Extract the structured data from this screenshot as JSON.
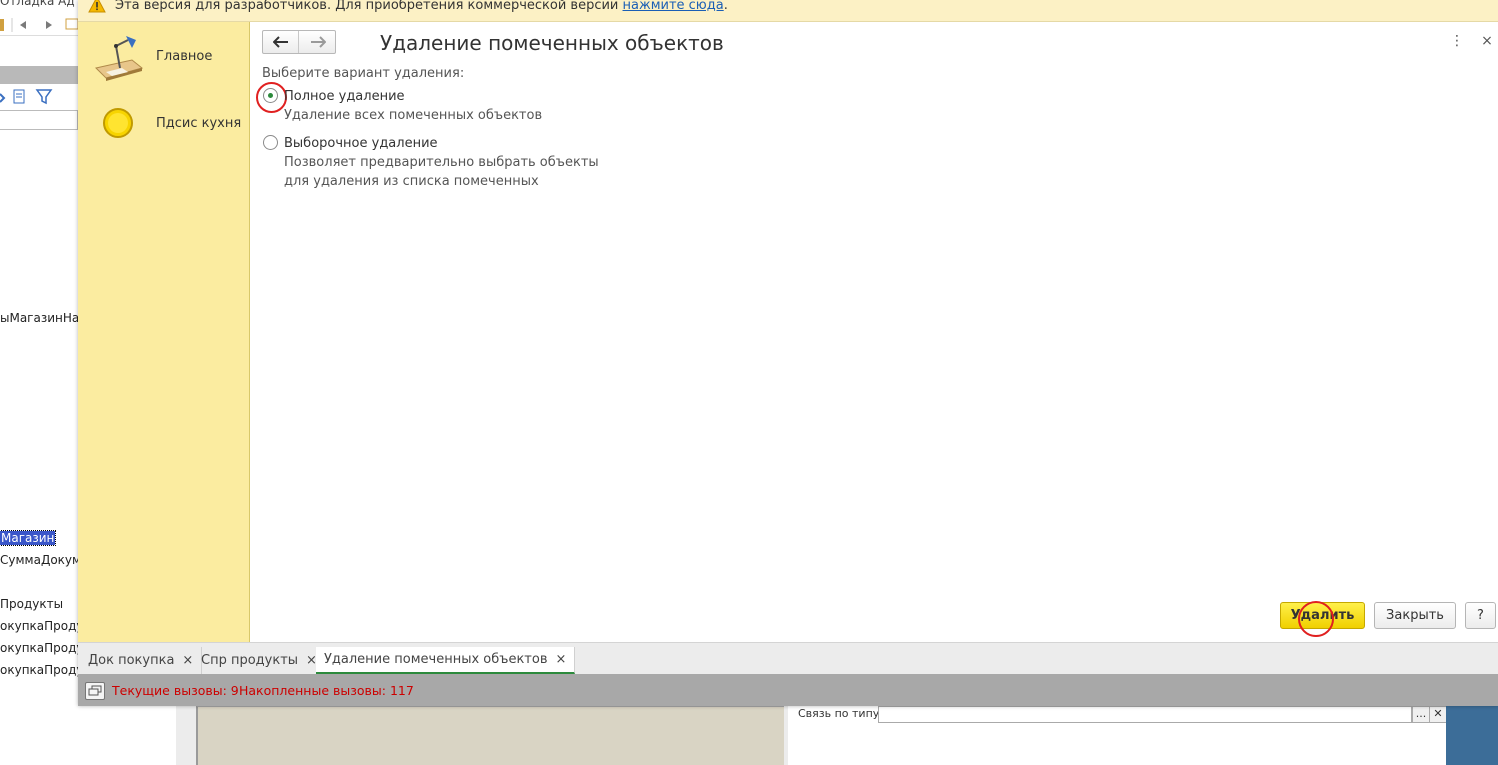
{
  "background": {
    "menu_fragment": "Отладка   Ад",
    "code_lines": [
      "ыМагазинНазва",
      "Магазин",
      "СуммаДокумен",
      "Продукты",
      "окупкаПродук",
      "окупкаПродук",
      "окупкаПродук"
    ],
    "bottom_panel": {
      "link_by_type_label": "Связь по типу",
      "ellipsis_button": "...",
      "clear_button": "✕"
    }
  },
  "banner": {
    "text": "Эта версия для разработчиков. Для приобретения коммерческой версии",
    "link": "нажмите сюда",
    "suffix": "."
  },
  "sidebar": {
    "items": [
      {
        "label": "Главное",
        "icon": "desk-lamp-icon"
      },
      {
        "label": "Пдсис кухня",
        "icon": "yellow-circle-icon"
      }
    ]
  },
  "form": {
    "title": "Удаление помеченных объектов",
    "prompt": "Выберите вариант удаления:",
    "options": [
      {
        "title": "Полное удаление",
        "description": [
          "Удаление всех помеченных объектов"
        ],
        "checked": true
      },
      {
        "title": "Выборочное удаление",
        "description": [
          "Позволяет предварительно выбрать объекты",
          "для удаления из списка помеченных"
        ],
        "checked": false
      }
    ],
    "buttons": {
      "delete": "Удалить",
      "close": "Закрыть",
      "help": "?"
    },
    "header_icons": {
      "more": "⋮",
      "close": "×"
    }
  },
  "tabs": [
    {
      "label": "Док покупка",
      "active": false
    },
    {
      "label": "Спр продукты",
      "active": false
    },
    {
      "label": "Удаление помеченных объектов",
      "active": true
    }
  ],
  "tab_close": "×",
  "status": {
    "current_calls": "Текущие вызовы: 9",
    "accumulated_calls": "Накопленные вызовы: 117"
  },
  "colors": {
    "banner_bg": "#fcf1c5",
    "sidebar_bg": "#fbeca0",
    "accent_green": "#2c8a3c",
    "delete_button": "#f5da10",
    "status_text": "#cc0000",
    "annotation_red": "#e02020"
  }
}
